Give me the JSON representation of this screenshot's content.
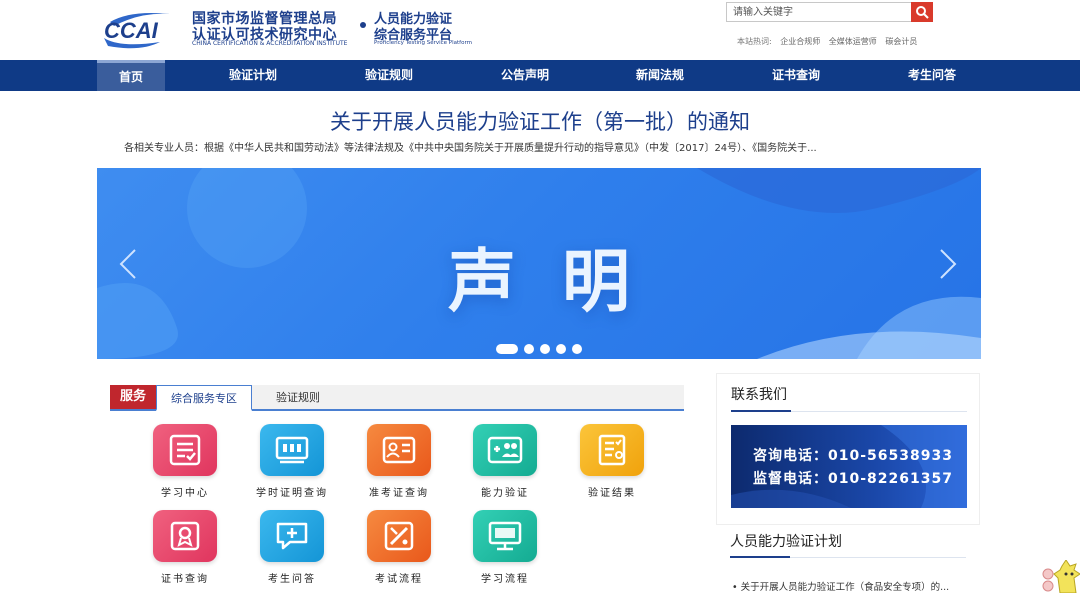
{
  "header": {
    "logo_text": "CCAI",
    "org_name_line1": "国家市场监督管理总局",
    "org_name_line2": "认证认可技术研究中心",
    "org_name_en": "CHINA CERTIFICATION & ACCREDITATION INSTITUTE",
    "platform_line1": "人员能力验证",
    "platform_line2": "综合服务平台",
    "platform_en": "Proficiency Testing Service Platform",
    "search_placeholder": "请输入关键字",
    "hot_label": "本站热词:",
    "hot_words": [
      "企业合规师",
      "全媒体运营师",
      "碳会计员"
    ]
  },
  "nav": {
    "items": [
      {
        "label": "首页",
        "active": true
      },
      {
        "label": "验证计划"
      },
      {
        "label": "验证规则"
      },
      {
        "label": "公告声明"
      },
      {
        "label": "新闻法规"
      },
      {
        "label": "证书查询"
      },
      {
        "label": "考生问答"
      }
    ]
  },
  "notice": {
    "title": "关于开展人员能力验证工作（第一批）的通知",
    "summary": "各相关专业人员：根据《中华人民共和国劳动法》等法律法规及《中共中央国务院关于开展质量提升行动的指导意见》（中发〔2017〕24号）、《国务院关于..."
  },
  "banner": {
    "text": "声明",
    "slide_count": 5,
    "active_slide": 1
  },
  "services": {
    "section_label": "服务",
    "tabs": [
      "综合服务专区",
      "验证规则"
    ],
    "items": [
      {
        "label": "学习中心",
        "icon": "study-center-icon",
        "color": "#e8486e"
      },
      {
        "label": "学时证明查询",
        "icon": "hours-certificate-icon",
        "color": "#1ea4e0"
      },
      {
        "label": "准考证查询",
        "icon": "admission-ticket-icon",
        "color": "#f06d2b"
      },
      {
        "label": "能力验证",
        "icon": "ability-verification-icon",
        "color": "#1fbfa6"
      },
      {
        "label": "验证结果",
        "icon": "verification-result-icon",
        "color": "#f4b31c"
      },
      {
        "label": "证书查询",
        "icon": "certificate-query-icon",
        "color": "#e8486e"
      },
      {
        "label": "考生问答",
        "icon": "candidate-qa-icon",
        "color": "#1ea4e0"
      },
      {
        "label": "考试流程",
        "icon": "exam-process-icon",
        "color": "#f06d2b"
      },
      {
        "label": "学习流程",
        "icon": "study-process-icon",
        "color": "#1fbfa6"
      }
    ]
  },
  "contact": {
    "title": "联系我们",
    "consult_line": "咨询电话：010-56538933",
    "supervise_line": "监督电话：010-82261357"
  },
  "plan": {
    "title": "人员能力验证计划",
    "items": [
      "• 关于开展人员能力验证工作（食品安全专项）的..."
    ]
  },
  "colors": {
    "primary": "#0f3a86",
    "accent_red": "#c0262d",
    "banner_blue": "#2f7fec"
  }
}
